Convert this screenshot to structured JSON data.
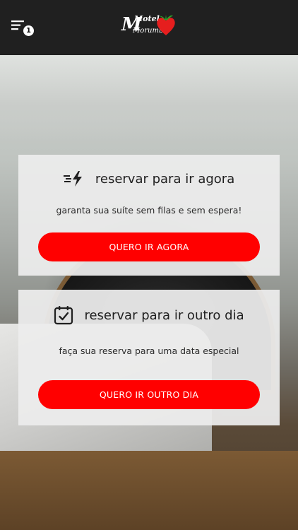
{
  "header": {
    "menu_badge": "1",
    "logo": {
      "line1": "Motel",
      "line2": "Morumbi",
      "icon": "strawberry-heart-icon"
    }
  },
  "cards": [
    {
      "icon": "fast-lightning-icon",
      "title": "reservar para ir agora",
      "subtitle": "garanta sua suíte sem filas e sem espera!",
      "button": "QUERO IR AGORA"
    },
    {
      "icon": "calendar-check-icon",
      "title": "reservar para ir outro dia",
      "subtitle": "faça sua reserva para uma data especial",
      "button": "QUERO IR OUTRO DIA"
    }
  ],
  "colors": {
    "header_bg": "#202020",
    "accent": "#ff0000",
    "card_bg": "#ececec"
  }
}
